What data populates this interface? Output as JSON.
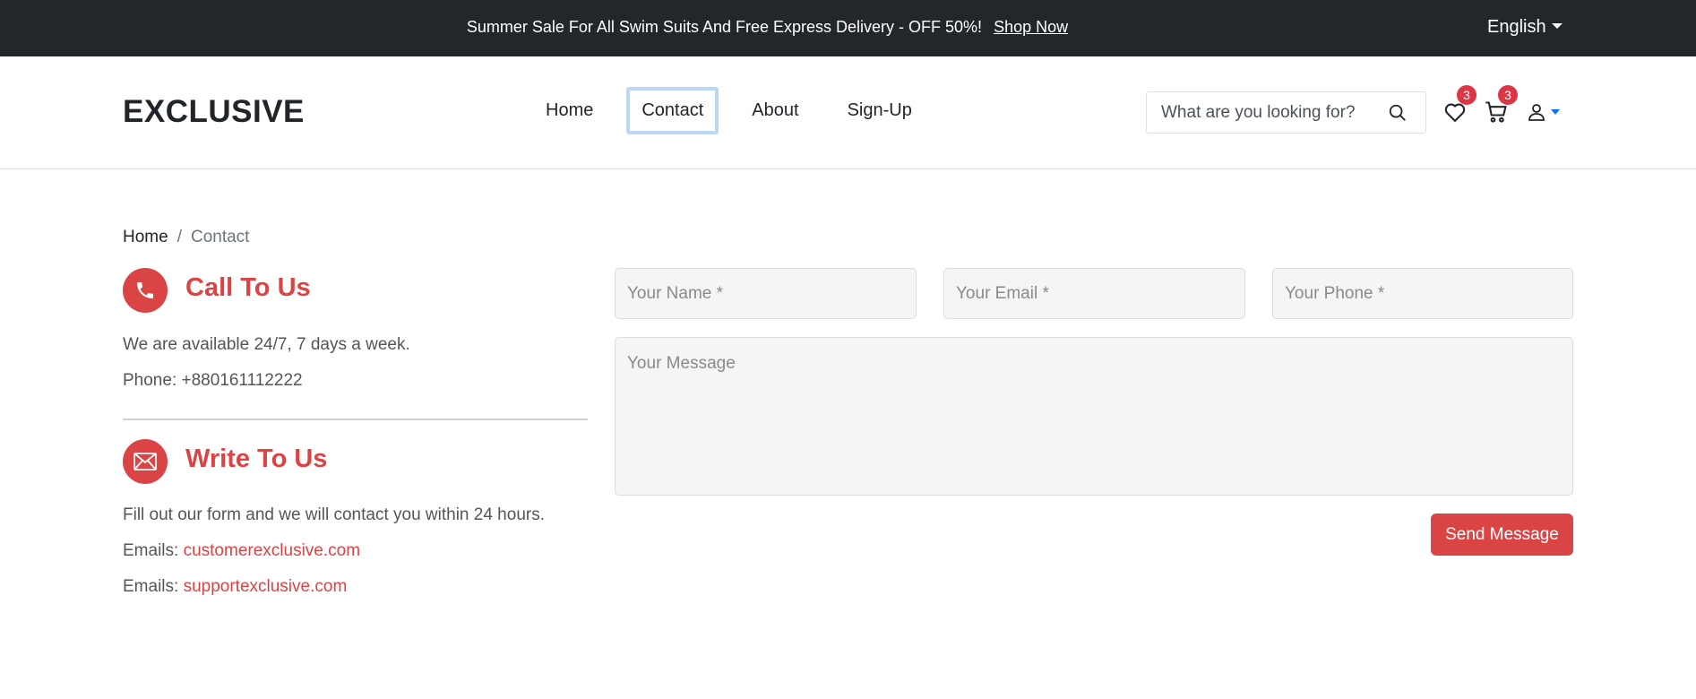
{
  "topbar": {
    "promo_text": "Summer Sale For All Swim Suits And Free Express Delivery - OFF 50%!",
    "promo_link": "Shop Now",
    "language": "English"
  },
  "header": {
    "logo": "EXCLUSIVE",
    "nav": [
      {
        "label": "Home"
      },
      {
        "label": "Contact"
      },
      {
        "label": "About"
      },
      {
        "label": "Sign-Up"
      }
    ],
    "search_placeholder": "What are you looking for?",
    "wishlist_count": "3",
    "cart_count": "3"
  },
  "breadcrumb": {
    "home": "Home",
    "separator": "/",
    "current": "Contact"
  },
  "call": {
    "title": "Call To Us",
    "line1": "We are available 24/7, 7 days a week.",
    "phone": "Phone: +880161112222"
  },
  "write": {
    "title": "Write To Us",
    "line1": "Fill out our form and we will contact you within 24 hours.",
    "email_prefix": "Emails:",
    "email1": "customerexclusive.com",
    "email2": "supportexclusive.com"
  },
  "form": {
    "name_placeholder": "Your Name *",
    "email_placeholder": "Your Email *",
    "phone_placeholder": "Your Phone *",
    "message_placeholder": "Your Message",
    "send_label": "Send Message"
  },
  "colors": {
    "accent": "#db4444",
    "topbar": "#23262b",
    "badge": "#dc3545"
  }
}
